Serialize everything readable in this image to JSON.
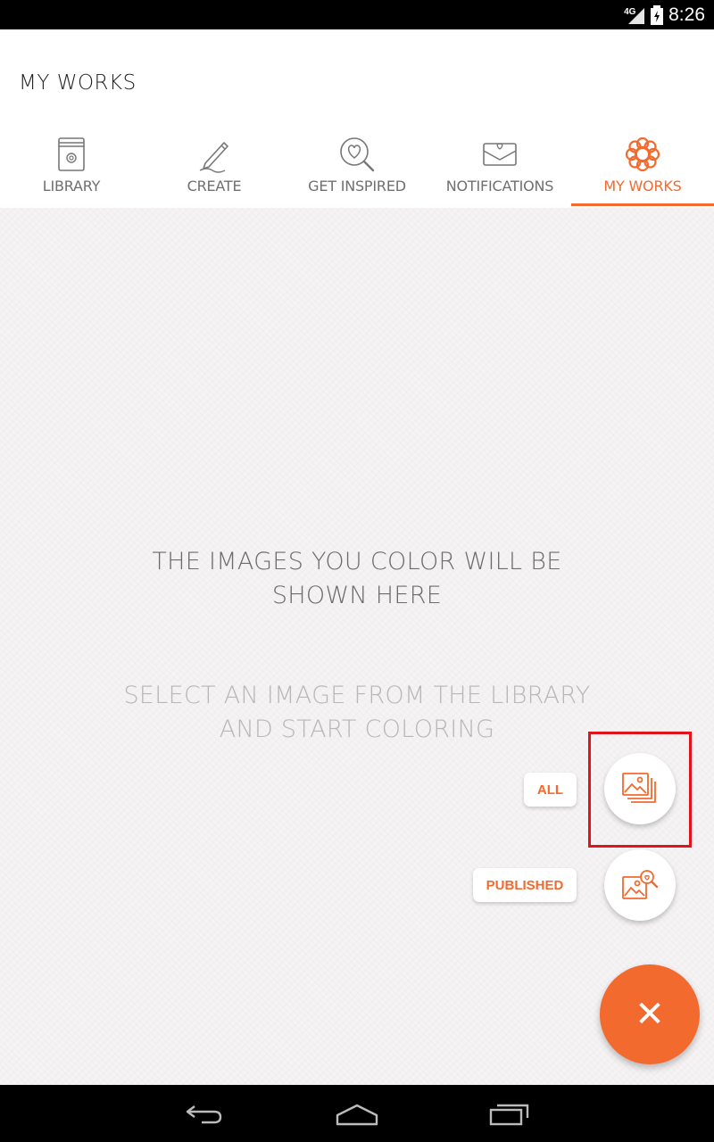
{
  "status_bar": {
    "network": "4G",
    "time": "8:26"
  },
  "header": {
    "title": "MY WORKS"
  },
  "tabs": [
    {
      "label": "LIBRARY",
      "icon": "library-book-icon",
      "active": false
    },
    {
      "label": "CREATE",
      "icon": "pencil-icon",
      "active": false
    },
    {
      "label": "GET INSPIRED",
      "icon": "heart-search-icon",
      "active": false
    },
    {
      "label": "NOTIFICATIONS",
      "icon": "envelope-icon",
      "active": false
    },
    {
      "label": "MY WORKS",
      "icon": "flower-icon",
      "active": true
    }
  ],
  "empty_state": {
    "title_line1": "THE IMAGES YOU COLOR WILL BE",
    "title_line2": "SHOWN HERE",
    "subtitle_line1": "SELECT AN IMAGE FROM THE LIBRARY",
    "subtitle_line2": "AND START COLORING"
  },
  "fab_menu": {
    "all_label": "ALL",
    "published_label": "PUBLISHED",
    "all_icon": "gallery-stack-icon",
    "published_icon": "gallery-search-icon",
    "close_icon": "close-icon",
    "close_symbol": "✕"
  },
  "colors": {
    "accent": "#f26a2e",
    "highlight": "#e3131b"
  },
  "nav_bar": {
    "back_icon": "back-icon",
    "home_icon": "home-icon",
    "recents_icon": "recents-icon"
  }
}
